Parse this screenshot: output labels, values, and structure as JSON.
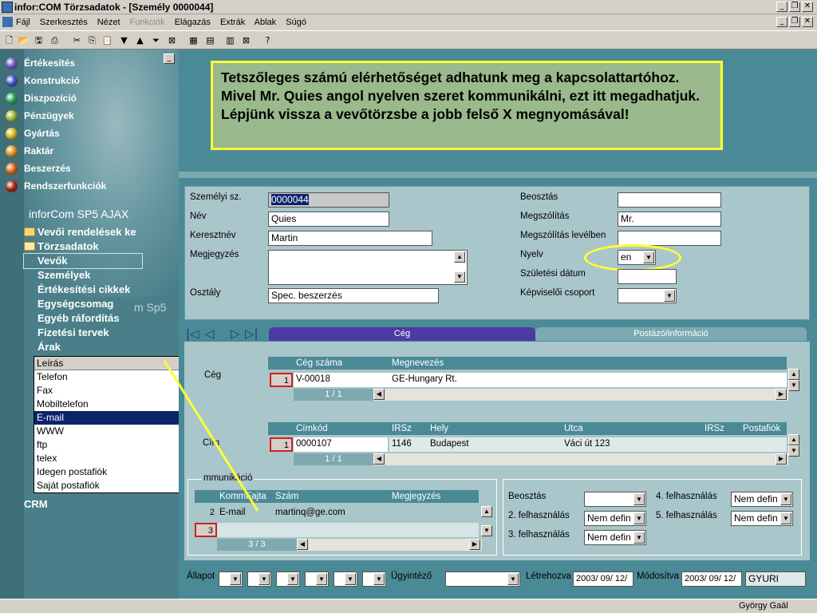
{
  "window": {
    "title": "infor:COM Törzsadatok - [Személy 0000044]"
  },
  "menu": [
    "Fájl",
    "Szerkesztés",
    "Nézet",
    "Funkciók",
    "Elágazás",
    "Extrák",
    "Ablak",
    "Súgó"
  ],
  "nav": {
    "items": [
      "Értékesítés",
      "Konstrukció",
      "Diszpozíció",
      "Pénzügyek",
      "Gyártás",
      "Raktár",
      "Beszerzés",
      "Rendszerfunkciók"
    ],
    "ball_colors": [
      "#6a55c0",
      "#3a4fc0",
      "#22a05a",
      "#9ab030",
      "#d8b020",
      "#e09020",
      "#e05a10",
      "#a02010"
    ],
    "product": "inforCom SP5 AJAX",
    "product_shadow": "m Sp5",
    "tree": {
      "folder1": "Vevői rendelések ke",
      "folder2": "Törzsadatok",
      "leaves": [
        "Vevők",
        "Személyek",
        "Értékesítési cikkek",
        "Egységcsomag",
        "Egyéb ráfordítás",
        "Fizetési tervek",
        "Árak"
      ],
      "bottom": "CRM"
    }
  },
  "dropdown": {
    "header": "Leírás",
    "options": [
      "Telefon",
      "Fax",
      "Mobiltelefon",
      "E-mail",
      "WWW",
      "ftp",
      "telex",
      "Idegen postafiók",
      "Saját postafiók"
    ],
    "selected": "E-mail"
  },
  "note": "Tetszőleges számú elérhetőséget adhatunk meg a kapcsolattartóhoz.  Mivel Mr. Quies angol nyelven szeret kommunikálni, ezt itt megadhatjuk. Lépjünk vissza a vevőtörzsbe a jobb felső X megnyomásával!",
  "form": {
    "labels": {
      "szemelyi": "Személyi sz.",
      "nev": "Név",
      "kereszt": "Keresztnév",
      "megj": "Megjegyzés",
      "osztaly": "Osztály",
      "beosztas": "Beosztás",
      "megszolitas": "Megszólítás",
      "megszolitas_lev": "Megszólítás levélben",
      "nyelv": "Nyelv",
      "szuletesi": "Születési dátum",
      "kepviseloi": "Képviselői csoport"
    },
    "values": {
      "szemelyi": "0000044",
      "nev": "Quies",
      "kereszt": "Martin",
      "osztaly": "Spec. beszerzés",
      "megszolitas": "Mr.",
      "nyelv": "en"
    }
  },
  "tabs": [
    "Cég",
    "Postázó/információ"
  ],
  "ceg": {
    "label": "Cég",
    "headers": [
      "Cég száma",
      "Megnevezés"
    ],
    "row": {
      "num": "1",
      "ceg_szama": "V-00018",
      "megnevezes": "GE-Hungary Rt."
    },
    "pager": "1 / 1"
  },
  "cim": {
    "label": "Cím",
    "headers": [
      "Címkód",
      "IRSz",
      "Hely",
      "Utca",
      "IRSz",
      "Postafiók"
    ],
    "row": {
      "num": "1",
      "cimkod": "0000107",
      "irsz": "1146",
      "hely": "Budapest",
      "utca": "Váci út 123"
    },
    "pager": "1 / 1"
  },
  "komm": {
    "label": "mmunikáció",
    "headers": [
      "KommFajta",
      "Szám",
      "Megjegyzés"
    ],
    "rows": [
      {
        "num": "2",
        "fajta": "E-mail",
        "szam": "martinq@ge.com"
      },
      {
        "num": "3"
      }
    ],
    "pager": "3 / 3"
  },
  "right_panel": {
    "labels": [
      "Beosztás",
      "2. felhasználás",
      "3. felhasználás",
      "4. felhasználás",
      "5. felhasználás"
    ],
    "nem_defin": "Nem defin"
  },
  "status": {
    "allapot": "Állapot",
    "ugyintezo": "Ügyintéző",
    "letrehozva": "Létrehozva",
    "letrehozva_val": "2003/ 09/ 12/",
    "modositva": "Módosítva",
    "modositva_val": "2003/ 09/ 12/",
    "user": "GYURI"
  },
  "bottom_user": "György Gaál",
  "colors": {
    "accent_yellow": "#ffff33",
    "selection": "#0a246a",
    "tab_active": "#4b3aa3"
  }
}
